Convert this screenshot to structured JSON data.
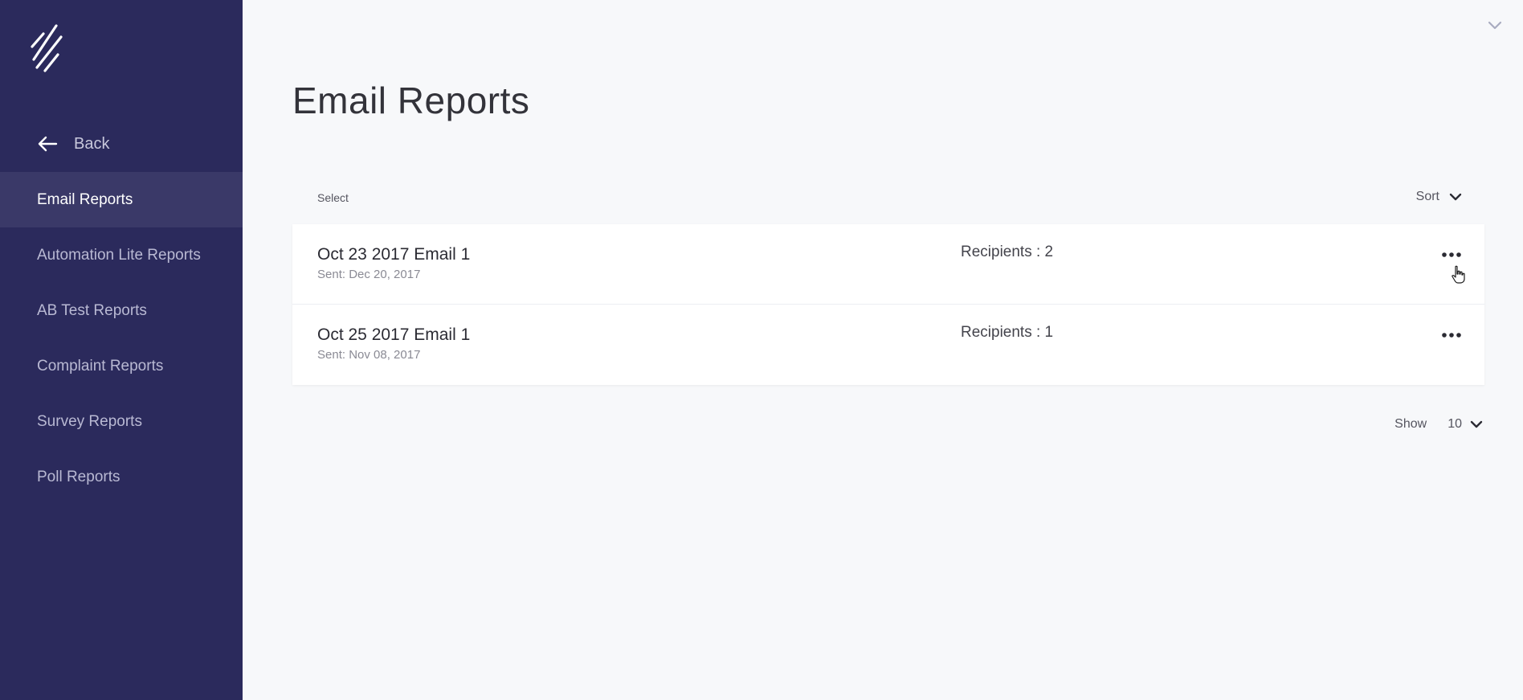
{
  "sidebar": {
    "logo_icon": "slashes-logo",
    "back_label": "Back",
    "items": [
      {
        "label": "Email Reports",
        "active": true
      },
      {
        "label": "Automation Lite Reports",
        "active": false
      },
      {
        "label": "AB Test Reports",
        "active": false
      },
      {
        "label": "Complaint Reports",
        "active": false
      },
      {
        "label": "Survey Reports",
        "active": false
      },
      {
        "label": "Poll Reports",
        "active": false
      }
    ]
  },
  "header": {
    "title": "Email Reports"
  },
  "list": {
    "select_label": "Select",
    "sort_label": "Sort",
    "rows": [
      {
        "title": "Oct 23 2017 Email 1",
        "sent": "Sent: Dec 20, 2017",
        "recipients": "Recipients : 2"
      },
      {
        "title": "Oct 25 2017 Email 1",
        "sent": "Sent: Nov 08, 2017",
        "recipients": "Recipients : 1"
      }
    ]
  },
  "pager": {
    "show_label": "Show",
    "page_size": "10"
  },
  "colors": {
    "sidebar_bg": "#2b2a5c",
    "sidebar_active_bg": "#3a3968",
    "page_bg": "#f7f8fa"
  }
}
